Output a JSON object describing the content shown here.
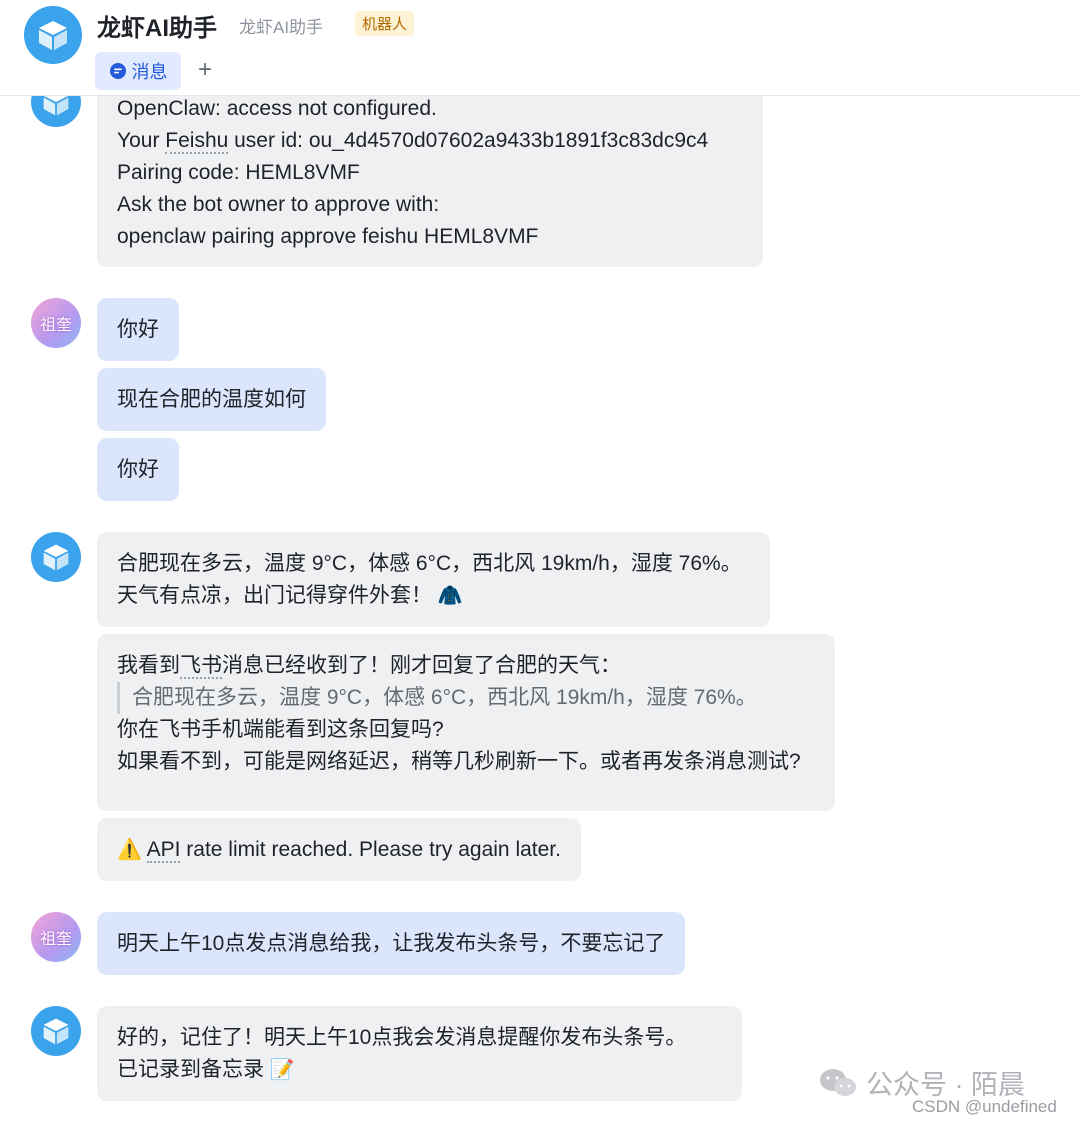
{
  "header": {
    "title": "龙虾AI助手",
    "subtitle": "龙虾AI助手",
    "badge": "机器人",
    "tab_label": "消息",
    "add_label": "+"
  },
  "messages": {
    "m1": {
      "l1": "OpenClaw: access not configured.",
      "l2a": "Your ",
      "l2b": "Feishu",
      "l2c": " user id: ou_4d4570d07602a9433b1891f3c83dc9c4",
      "l3": "Pairing code: HEML8VMF",
      "l4": "Ask the bot owner to approve with:",
      "l5": "openclaw pairing approve feishu HEML8VMF"
    },
    "user_avatar_text": "祖奎",
    "u1": "你好",
    "u2": "现在合肥的温度如何",
    "u3": "你好",
    "b1": {
      "l1": "合肥现在多云，温度 9°C，体感 6°C，西北风 19km/h，湿度 76%。",
      "l2": "天气有点凉，出门记得穿件外套！",
      "emoji": "🧥"
    },
    "b2": {
      "l1a": "我看到",
      "l1b": "飞书",
      "l1c": "消息已经收到了！刚才回复了合肥的天气：",
      "quote": "合肥现在多云，温度 9°C，体感 6°C，西北风 19km/h，湿度 76%。",
      "l3": "你在飞书手机端能看到这条回复吗?",
      "l4": "如果看不到，可能是网络延迟，稍等几秒刷新一下。或者再发条消息测试?"
    },
    "b3": {
      "icon": "⚠️",
      "a": "API",
      "b": " rate limit reached. Please try again later."
    },
    "u4": "明天上午10点发点消息给我，让我发布头条号，不要忘记了",
    "b4": {
      "l1": "好的，记住了！明天上午10点我会发消息提醒你发布头条号。",
      "l2": "已记录到备忘录",
      "emoji": "📝"
    }
  },
  "watermark": {
    "text": "公众号 · 陌晨",
    "csdn": "CSDN @undefined"
  },
  "colors": {
    "bot_avatar": "#3aa3ec",
    "user_bubble": "#dbe6fd",
    "bot_bubble": "#eff0f1",
    "tab_text": "#245bdb"
  }
}
